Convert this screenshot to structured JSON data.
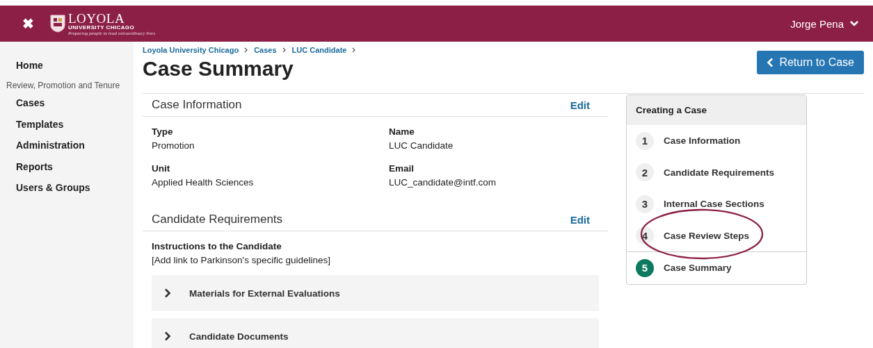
{
  "header": {
    "close": "✖",
    "logo": {
      "name": "LOYOLA",
      "sub": "UNIVERSITY CHICAGO",
      "tagline": "Preparing people to lead extraordinary lives"
    },
    "user": "Jorge Pena"
  },
  "sidebar": {
    "items": [
      {
        "label": "Home",
        "kind": "link"
      },
      {
        "label": "Review, Promotion and Tenure",
        "kind": "heading"
      },
      {
        "label": "Cases",
        "kind": "link"
      },
      {
        "label": "Templates",
        "kind": "link"
      },
      {
        "label": "Administration",
        "kind": "link"
      },
      {
        "label": "Reports",
        "kind": "link"
      },
      {
        "label": "Users & Groups",
        "kind": "link"
      }
    ]
  },
  "breadcrumbs": [
    "Loyola University Chicago",
    "Cases",
    "LUC Candidate"
  ],
  "page_title": "Case Summary",
  "return_button": "Return to Case",
  "sections": [
    {
      "title": "Case Information",
      "edit": "Edit",
      "fields": [
        {
          "label": "Type",
          "value": "Promotion"
        },
        {
          "label": "Name",
          "value": "LUC Candidate"
        },
        {
          "label": "Unit",
          "value": "Applied Health Sciences"
        },
        {
          "label": "Email",
          "value": "LUC_candidate@intf.com"
        }
      ]
    },
    {
      "title": "Candidate Requirements",
      "edit": "Edit",
      "instructions_label": "Instructions to the Candidate",
      "instructions": "[Add link to Parkinson's specific guidelines]",
      "items": [
        {
          "label": "Materials for External Evaluations",
          "expanded": false
        },
        {
          "label": "Candidate Documents",
          "expanded": false
        }
      ]
    }
  ],
  "steps": {
    "title": "Creating a Case",
    "items": [
      {
        "number": "1",
        "label": "Case Information",
        "selected": false
      },
      {
        "number": "2",
        "label": "Candidate Requirements",
        "selected": false
      },
      {
        "number": "3",
        "label": "Internal Case Sections",
        "selected": false
      },
      {
        "number": "4",
        "label": "Case Review Steps",
        "selected": false
      },
      {
        "number": "5",
        "label": "Case Summary",
        "selected": true
      }
    ]
  }
}
